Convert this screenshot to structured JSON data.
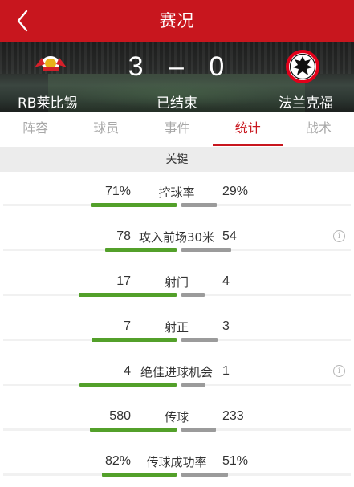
{
  "header": {
    "title": "赛况",
    "back_icon": "chevron-left-icon"
  },
  "match": {
    "home_team": "RB莱比锡",
    "away_team": "法兰克福",
    "home_score": "3",
    "away_score": "0",
    "score_separator": "–",
    "status": "已结束",
    "home_logo": "rb-leipzig-logo",
    "away_logo": "eintracht-frankfurt-logo"
  },
  "tabs": [
    {
      "label": "阵容",
      "active": false
    },
    {
      "label": "球员",
      "active": false
    },
    {
      "label": "事件",
      "active": false
    },
    {
      "label": "统计",
      "active": true
    },
    {
      "label": "战术",
      "active": false
    }
  ],
  "section": {
    "title": "关键"
  },
  "stats": [
    {
      "label": "控球率",
      "home": "71%",
      "away": "29%",
      "home_value": 71,
      "away_value": 29,
      "info": false
    },
    {
      "label": "攻入前场30米",
      "home": "78",
      "away": "54",
      "home_value": 78,
      "away_value": 54,
      "info": true
    },
    {
      "label": "射门",
      "home": "17",
      "away": "4",
      "home_value": 17,
      "away_value": 4,
      "info": false
    },
    {
      "label": "射正",
      "home": "7",
      "away": "3",
      "home_value": 7,
      "away_value": 3,
      "info": false
    },
    {
      "label": "绝佳进球机会",
      "home": "4",
      "away": "1",
      "home_value": 4,
      "away_value": 1,
      "info": true
    },
    {
      "label": "传球",
      "home": "580",
      "away": "233",
      "home_value": 580,
      "away_value": 233,
      "info": false
    },
    {
      "label": "传球成功率",
      "home": "82%",
      "away": "51%",
      "home_value": 82,
      "away_value": 51,
      "info": false
    }
  ],
  "colors": {
    "brand": "#c8161e",
    "home_bar": "#53a02a",
    "away_bar": "#9b9b9b",
    "tab_inactive": "#a8a8a8"
  }
}
